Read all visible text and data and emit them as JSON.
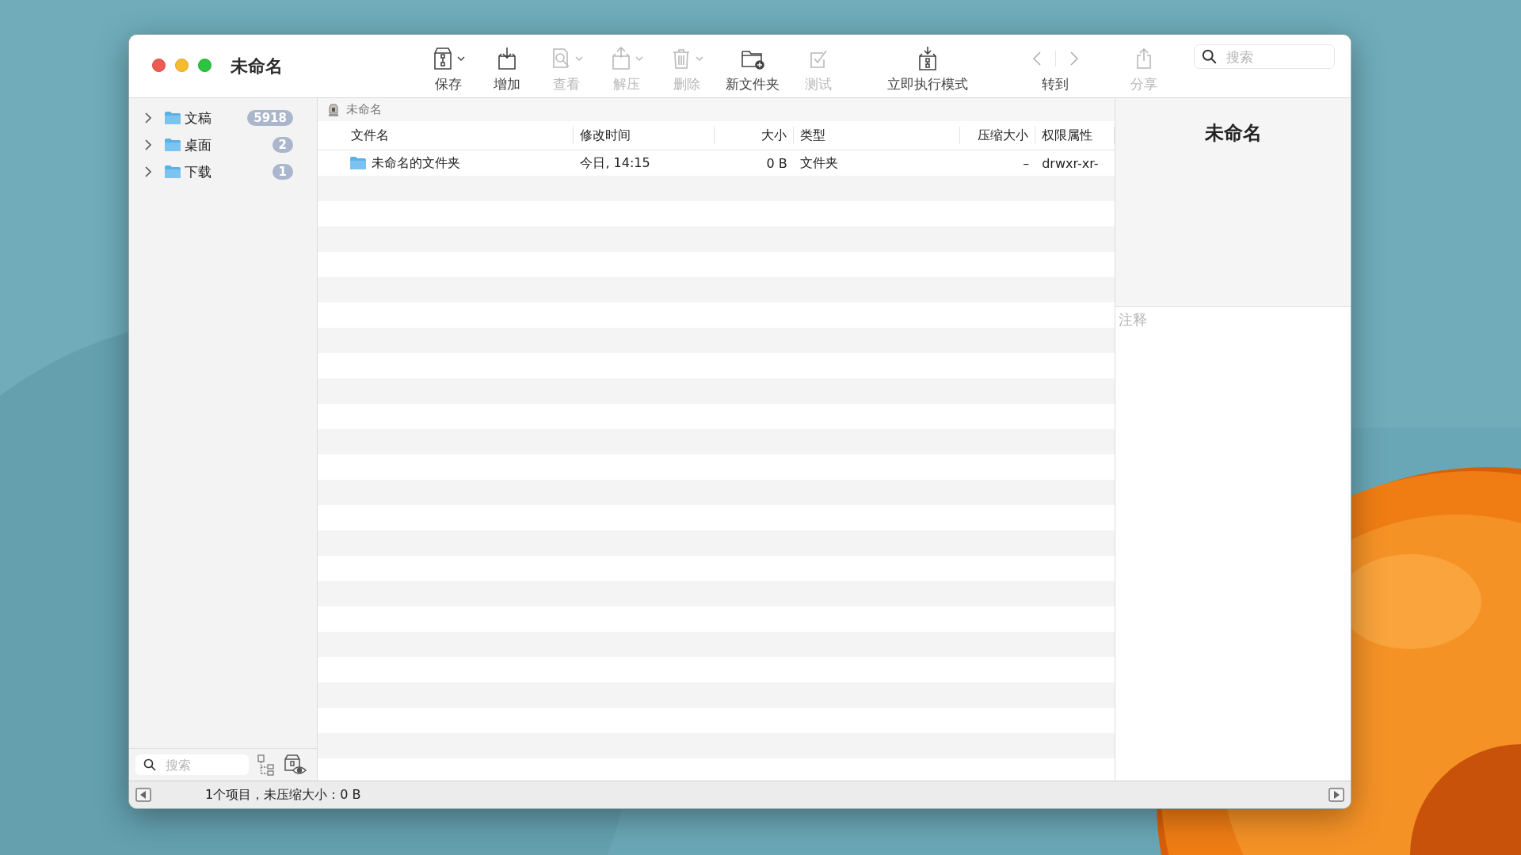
{
  "window": {
    "title": "未命名"
  },
  "toolbar": {
    "items": [
      {
        "label": "保存",
        "disabled": false,
        "menu": true
      },
      {
        "label": "增加",
        "disabled": false,
        "menu": false
      },
      {
        "label": "查看",
        "disabled": true,
        "menu": true
      },
      {
        "label": "解压",
        "disabled": true,
        "menu": true
      },
      {
        "label": "删除",
        "disabled": true,
        "menu": true
      },
      {
        "label": "新文件夹",
        "disabled": false,
        "menu": false
      },
      {
        "label": "测试",
        "disabled": true,
        "menu": false
      },
      {
        "label": "立即执行模式",
        "disabled": false,
        "menu": false
      }
    ],
    "navigation": {
      "label": "转到",
      "back_disabled": true,
      "forward_disabled": true
    },
    "share": {
      "label": "分享",
      "disabled": true
    },
    "search": {
      "placeholder": "搜索"
    }
  },
  "sidebar": {
    "items": [
      {
        "label": "文稿",
        "count": "5918",
        "expanded": false
      },
      {
        "label": "桌面",
        "count": "2",
        "expanded": false
      },
      {
        "label": "下载",
        "count": "1",
        "expanded": false
      }
    ],
    "search": {
      "placeholder": "搜索"
    }
  },
  "path_bar": {
    "label": "未命名"
  },
  "table": {
    "columns": [
      "文件名",
      "修改时间",
      "大小",
      "类型",
      "压缩大小",
      "权限属性"
    ],
    "rows": [
      {
        "cells": [
          "未命名的文件夹",
          "今日, 14:15",
          "0 B",
          "文件夹",
          "–",
          "drwxr-xr-"
        ]
      }
    ]
  },
  "inspector": {
    "title": "未命名",
    "comment": {
      "placeholder": "注释"
    }
  },
  "status_bar": {
    "text": "1个项目，未压缩大小：0 B"
  }
}
